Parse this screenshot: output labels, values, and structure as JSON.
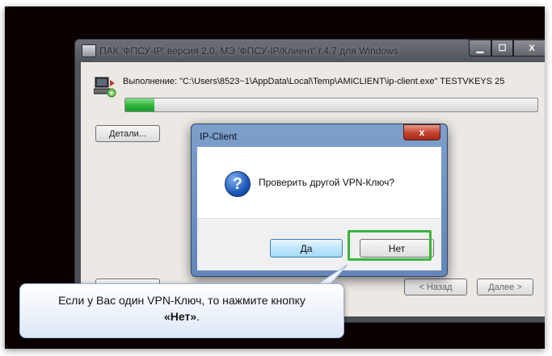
{
  "installer": {
    "title": "ПАК 'ФПСУ-IP' версия 2.0, МЭ 'ФПСУ-IP/Клиент' г.4.7 для Windows",
    "exec_text": "Выполнение: \"C:\\Users\\8523~1\\AppData\\Local\\Temp\\AMICLIENT\\ip-client.exe\" TESTVKEYS 25",
    "progress": 0.07,
    "details_label": "Детали...",
    "back_label": "< Назад",
    "next_label": "Далее >",
    "caption": {
      "min": "▁",
      "max": "☐",
      "close": "X"
    }
  },
  "dialog": {
    "title": "IP-Client",
    "message": "Проверить другой VPN-Ключ?",
    "yes_label": "Да",
    "no_label": "Нет",
    "close_glyph": "x",
    "icon_glyph": "?"
  },
  "callout": {
    "line1": "Если у Вас один VPN-Ключ, то нажмите кнопку",
    "line2_bold": "«Нет»",
    "line2_tail": "."
  },
  "colors": {
    "highlight": "#3bb53b",
    "progress": "#2fb33d",
    "background": "#0a0000"
  }
}
